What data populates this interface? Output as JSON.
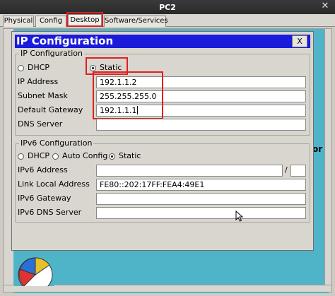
{
  "window": {
    "title": "PC2",
    "close_glyph": "✕"
  },
  "tabs": [
    {
      "label": "Physical",
      "active": false
    },
    {
      "label": "Config",
      "active": false
    },
    {
      "label": "Desktop",
      "active": true
    },
    {
      "label": "Software/Services",
      "active": false
    }
  ],
  "desktop": {
    "peek_text": "or"
  },
  "dialog": {
    "title": "IP Configuration",
    "close_label": "X",
    "ipv4": {
      "group_label": "IP Configuration",
      "dhcp_label": "DHCP",
      "static_label": "Static",
      "selected": "Static",
      "fields": [
        {
          "label": "IP Address",
          "value": "192.1.1.2"
        },
        {
          "label": "Subnet Mask",
          "value": "255.255.255.0"
        },
        {
          "label": "Default Gateway",
          "value": "192.1.1.1"
        },
        {
          "label": "DNS Server",
          "value": ""
        }
      ]
    },
    "ipv6": {
      "group_label": "IPv6 Configuration",
      "dhcp_label": "DHCP",
      "auto_label": "Auto Config",
      "static_label": "Static",
      "selected": "Static",
      "address_label": "IPv6 Address",
      "address_value": "",
      "prefix_sep": "/",
      "prefix_value": "",
      "link_local_label": "Link Local Address",
      "link_local_value": "FE80::202:17FF:FEA4:49E1",
      "gateway_label": "IPv6 Gateway",
      "gateway_value": "",
      "dns_label": "IPv6 DNS Server",
      "dns_value": ""
    }
  },
  "colors": {
    "dialog_header": "#1b1bdb",
    "desktop_bg": "#4fb4c8",
    "highlight": "#e02020"
  }
}
